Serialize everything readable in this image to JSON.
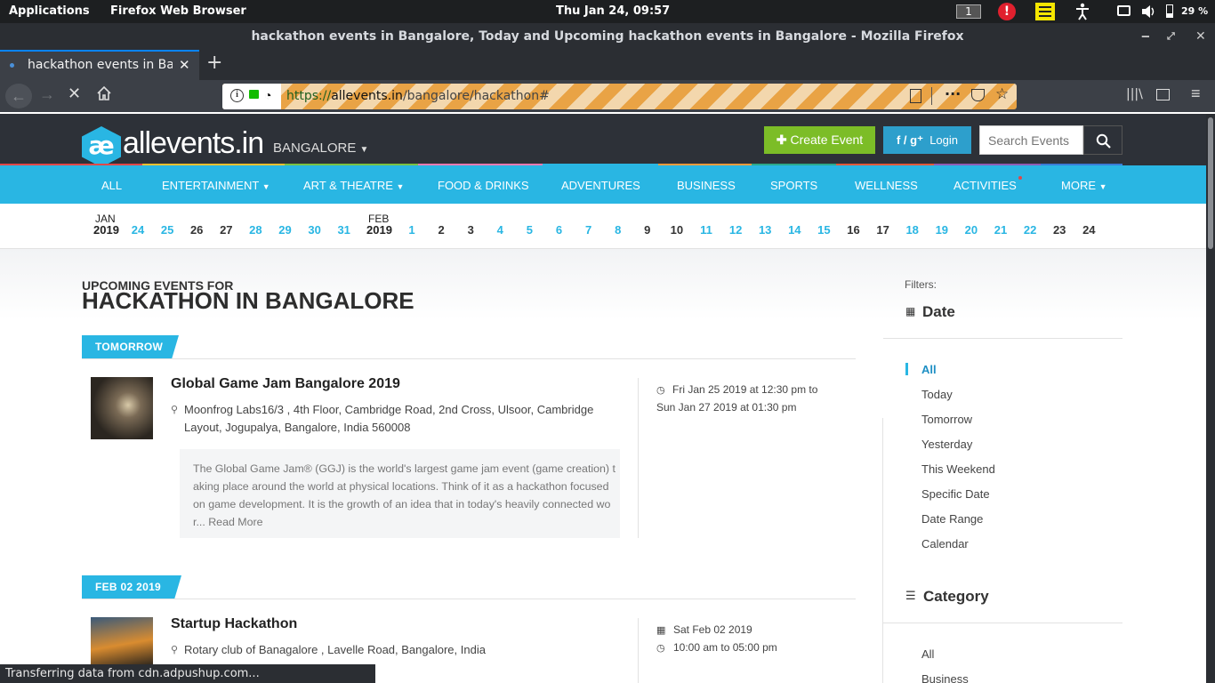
{
  "topbar": {
    "applications": "Applications",
    "app_name": "Firefox Web Browser",
    "clock": "Thu Jan 24, 09:57",
    "workspace": "1",
    "battery": "29 %"
  },
  "window": {
    "title": "hackathon events in Bangalore, Today and Upcoming hackathon events in Bangalore - Mozilla Firefox"
  },
  "tab": {
    "label": "hackathon events in Banc",
    "new_tab": "+"
  },
  "url": {
    "https": "https://",
    "host": "allevents.in",
    "path": "/bangalore/hackathon#"
  },
  "site": {
    "logo_mark": "æ",
    "logo_text": "allevents.in",
    "city": "BANGALORE",
    "create_event": "Create Event",
    "login_icons": "f / g⁺",
    "login": "Login",
    "search_placeholder": "Search Events"
  },
  "categories": [
    "ALL",
    "ENTERTAINMENT",
    "ART & THEATRE",
    "FOOD & DRINKS",
    "ADVENTURES",
    "BUSINESS",
    "SPORTS",
    "WELLNESS",
    "ACTIVITIES",
    "MORE"
  ],
  "dates": {
    "jan_month": "JAN",
    "jan_year": "2019",
    "feb_month": "FEB",
    "feb_year": "2019",
    "jan_days": [
      "24",
      "25",
      "26",
      "27",
      "28",
      "29",
      "30",
      "31"
    ],
    "feb_days": [
      "1",
      "2",
      "3",
      "4",
      "5",
      "6",
      "7",
      "8",
      "9",
      "10",
      "11",
      "12",
      "13",
      "14",
      "15",
      "16",
      "17",
      "18",
      "19",
      "20",
      "21",
      "22",
      "23",
      "24"
    ]
  },
  "heading": {
    "small": "UPCOMING EVENTS FOR",
    "big": "HACKATHON IN BANGALORE"
  },
  "section1": {
    "label": "TOMORROW"
  },
  "event1": {
    "title": "Global Game Jam Bangalore 2019",
    "address_line1": "Moonfrog Labs16/3 , 4th Floor, Cambridge Road, 2nd Cross, Ulsoor, Cambridge",
    "address_line2": "Layout, Jogupalya, Bangalore, India 560008",
    "desc_lines": [
      "The Global Game Jam® (GGJ) is the world's largest game jam event (game creation) t",
      "aking place around the world at physical locations. Think of it as a hackathon focused",
      "on game development. It is the growth of an idea that in today's heavily connected wo",
      "r..."
    ],
    "read_more": "Read More",
    "time_line1": "Fri Jan 25 2019 at 12:30 pm to",
    "time_line2": "Sun Jan 27 2019 at 01:30 pm"
  },
  "section2": {
    "label": "FEB 02 2019"
  },
  "event2": {
    "title": "Startup Hackathon",
    "address": "Rotary club of Banagalore , Lavelle Road, Bangalore, India",
    "date": "Sat Feb 02 2019",
    "time": "10:00 am to 05:00 pm"
  },
  "filters": {
    "label": "Filters:",
    "date_title": "Date",
    "date_options": [
      "All",
      "Today",
      "Tomorrow",
      "Yesterday",
      "This Weekend",
      "Specific Date",
      "Date Range",
      "Calendar"
    ],
    "category_title": "Category",
    "category_options": [
      "All",
      "Business"
    ]
  },
  "status": {
    "text": "Transferring data from cdn.adpushup.com..."
  }
}
